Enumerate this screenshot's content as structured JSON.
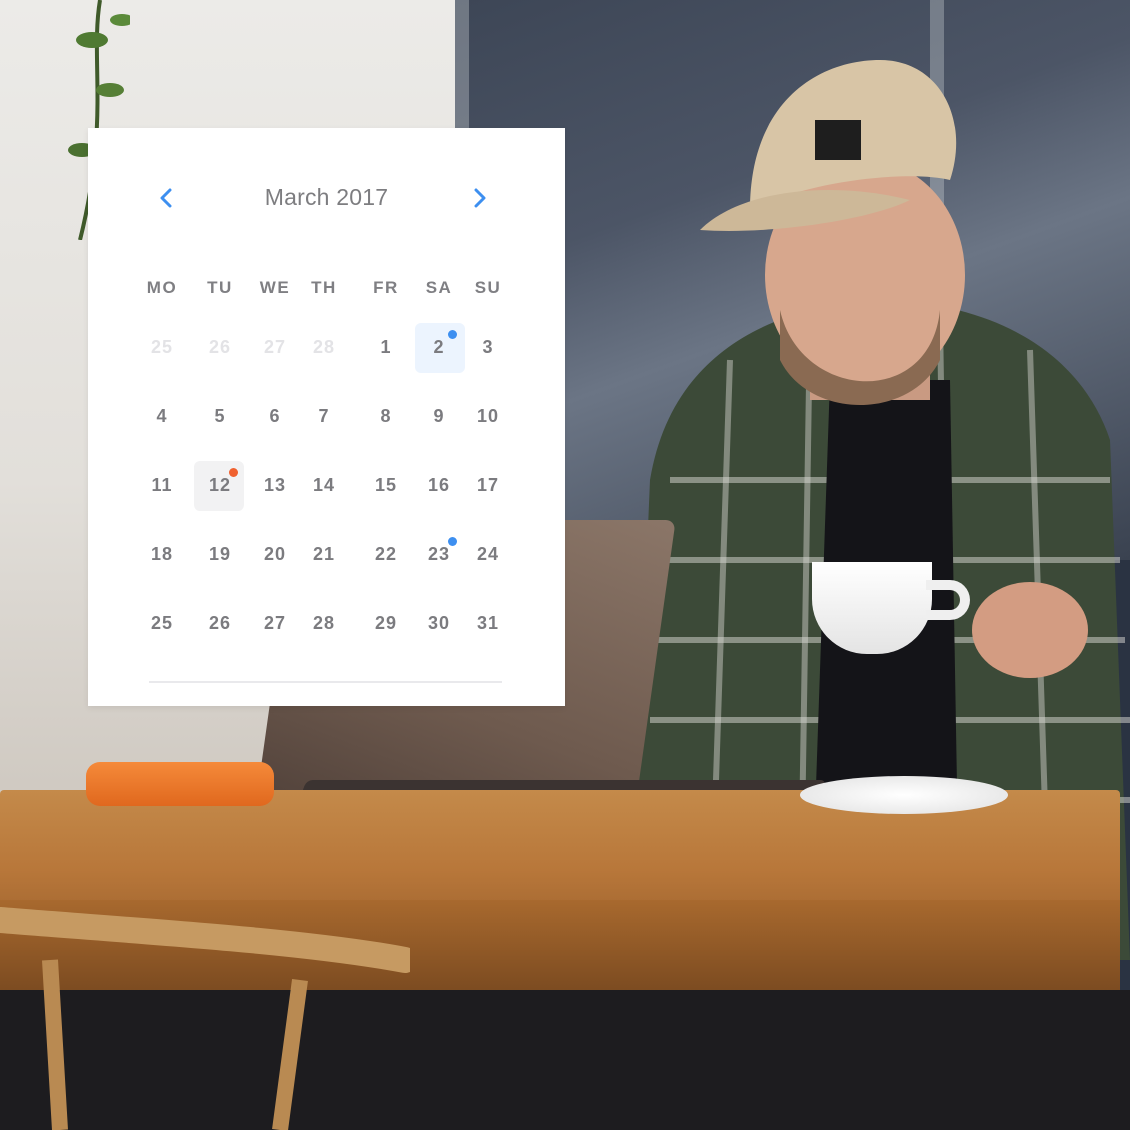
{
  "calendar": {
    "title": "March 2017",
    "prev_icon": "chevron-left-icon",
    "next_icon": "chevron-right-icon",
    "accent_color": "#3d8ff0",
    "weekdays": [
      "MO",
      "TU",
      "WE",
      "TH",
      "FR",
      "SA",
      "SU"
    ],
    "weeks": [
      [
        "25",
        "26",
        "27",
        "28",
        "1",
        "2",
        "3"
      ],
      [
        "4",
        "5",
        "6",
        "7",
        "8",
        "9",
        "10"
      ],
      [
        "11",
        "12",
        "13",
        "14",
        "15",
        "16",
        "17"
      ],
      [
        "18",
        "19",
        "20",
        "21",
        "22",
        "23",
        "24"
      ],
      [
        "25",
        "26",
        "27",
        "28",
        "29",
        "30",
        "31"
      ]
    ],
    "previous_month_days_shown": 4,
    "selected_day": "2",
    "today": "12",
    "events": [
      {
        "day": "2",
        "color": "#3d8ff0"
      },
      {
        "day": "12",
        "color": "#f0612f"
      },
      {
        "day": "23",
        "color": "#3d8ff0"
      }
    ]
  }
}
